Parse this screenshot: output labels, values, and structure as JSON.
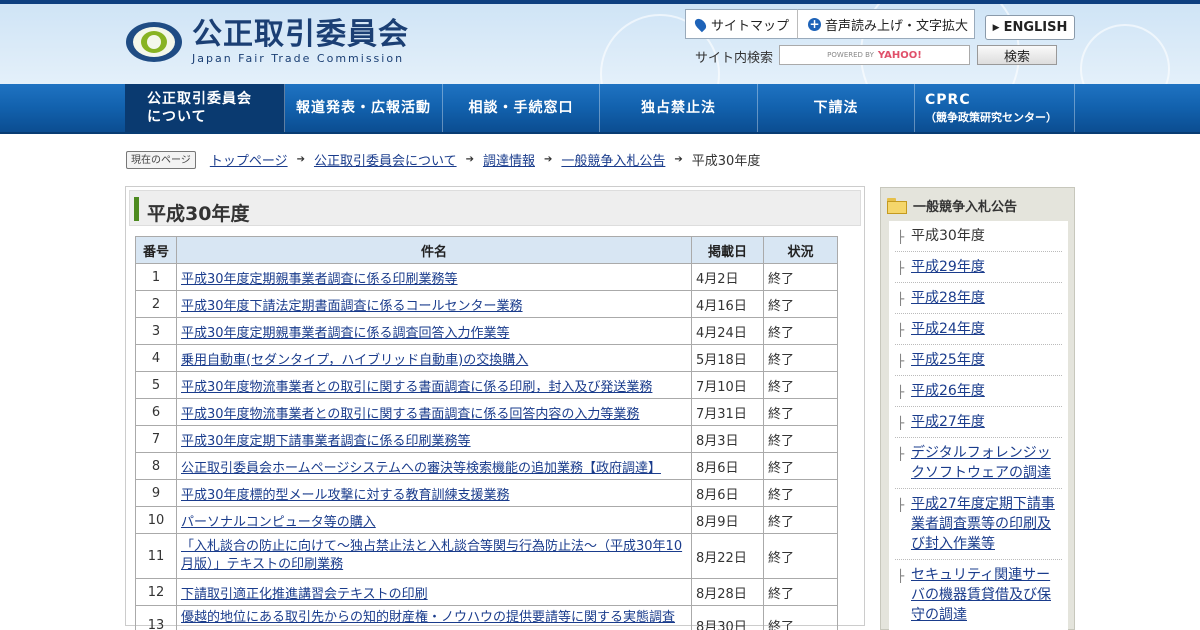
{
  "header": {
    "logo_jp": "公正取引委員会",
    "logo_en": "Japan Fair Trade Commission",
    "sitemap_label": "サイトマップ",
    "voice_label": "音声読み上げ・文字拡大",
    "english_label": "ENGLISH",
    "search_label": "サイト内検索",
    "search_placeholder_powered": "POWERED BY",
    "search_placeholder_brand": "YAHOO!",
    "search_button": "検索"
  },
  "nav": {
    "items": [
      {
        "line1": "公正取引委員会",
        "line2": "について"
      },
      {
        "label": "報道発表・広報活動"
      },
      {
        "label": "相談・手続窓口"
      },
      {
        "label": "独占禁止法"
      },
      {
        "label": "下請法"
      },
      {
        "line1": "CPRC",
        "line2": "（競争政策研究センター）"
      }
    ]
  },
  "breadcrumb": {
    "tag": "現在のページ",
    "items": [
      "トップページ",
      "公正取引委員会について",
      "調達情報",
      "一般競争入札公告"
    ],
    "current": "平成30年度"
  },
  "main": {
    "title": "平成30年度",
    "columns": [
      "番号",
      "件名",
      "掲載日",
      "状況"
    ],
    "rows": [
      {
        "no": "1",
        "title": "平成30年度定期親事業者調査に係る印刷業務等",
        "date": "4月2日",
        "status": "終了"
      },
      {
        "no": "2",
        "title": "平成30年度下請法定期書面調査に係るコールセンター業務",
        "date": "4月16日",
        "status": "終了"
      },
      {
        "no": "3",
        "title": "平成30年度定期親事業者調査に係る調査回答入力作業等",
        "date": "4月24日",
        "status": "終了"
      },
      {
        "no": "4",
        "title": "乗用自動車(セダンタイプ，ハイブリッド自動車)の交換購入",
        "date": "5月18日",
        "status": "終了"
      },
      {
        "no": "5",
        "title": "平成30年度物流事業者との取引に関する書面調査に係る印刷，封入及び発送業務",
        "date": "7月10日",
        "status": "終了"
      },
      {
        "no": "6",
        "title": "平成30年度物流事業者との取引に関する書面調査に係る回答内容の入力等業務",
        "date": "7月31日",
        "status": "終了"
      },
      {
        "no": "7",
        "title": "平成30年度定期下請事業者調査に係る印刷業務等",
        "date": "8月3日",
        "status": "終了"
      },
      {
        "no": "8",
        "title": "公正取引委員会ホームページシステムへの審決等検索機能の追加業務【政府調達】",
        "date": "8月6日",
        "status": "終了"
      },
      {
        "no": "9",
        "title": "平成30年度標的型メール攻撃に対する教育訓練支援業務",
        "date": "8月6日",
        "status": "終了"
      },
      {
        "no": "10",
        "title": "パーソナルコンピュータ等の購入",
        "date": "8月9日",
        "status": "終了"
      },
      {
        "no": "11",
        "title": "「入札談合の防止に向けて～独占禁止法と入札談合等関与行為防止法～（平成30年10月版）」テキストの印刷業務",
        "date": "8月22日",
        "status": "終了"
      },
      {
        "no": "12",
        "title": "下請取引適正化推進講習会テキストの印刷",
        "date": "8月28日",
        "status": "終了"
      },
      {
        "no": "13",
        "title": "優越的地位にある取引先からの知的財産権・ノウハウの提供要請等に関する実態調査に",
        "date": "8月30日",
        "status": "終了"
      }
    ]
  },
  "sidebar": {
    "title": "一般競争入札公告",
    "items": [
      {
        "label": "平成30年度",
        "current": true
      },
      {
        "label": "平成29年度"
      },
      {
        "label": "平成28年度"
      },
      {
        "label": "平成24年度"
      },
      {
        "label": "平成25年度"
      },
      {
        "label": "平成26年度"
      },
      {
        "label": "平成27年度"
      },
      {
        "label": "デジタルフォレンジックソフトウェアの調達"
      },
      {
        "label": "平成27年度定期下請事業者調査票等の印刷及び封入作業等"
      },
      {
        "label": "セキュリティ関連サーバの機器賃貸借及び保守の調達"
      }
    ]
  }
}
